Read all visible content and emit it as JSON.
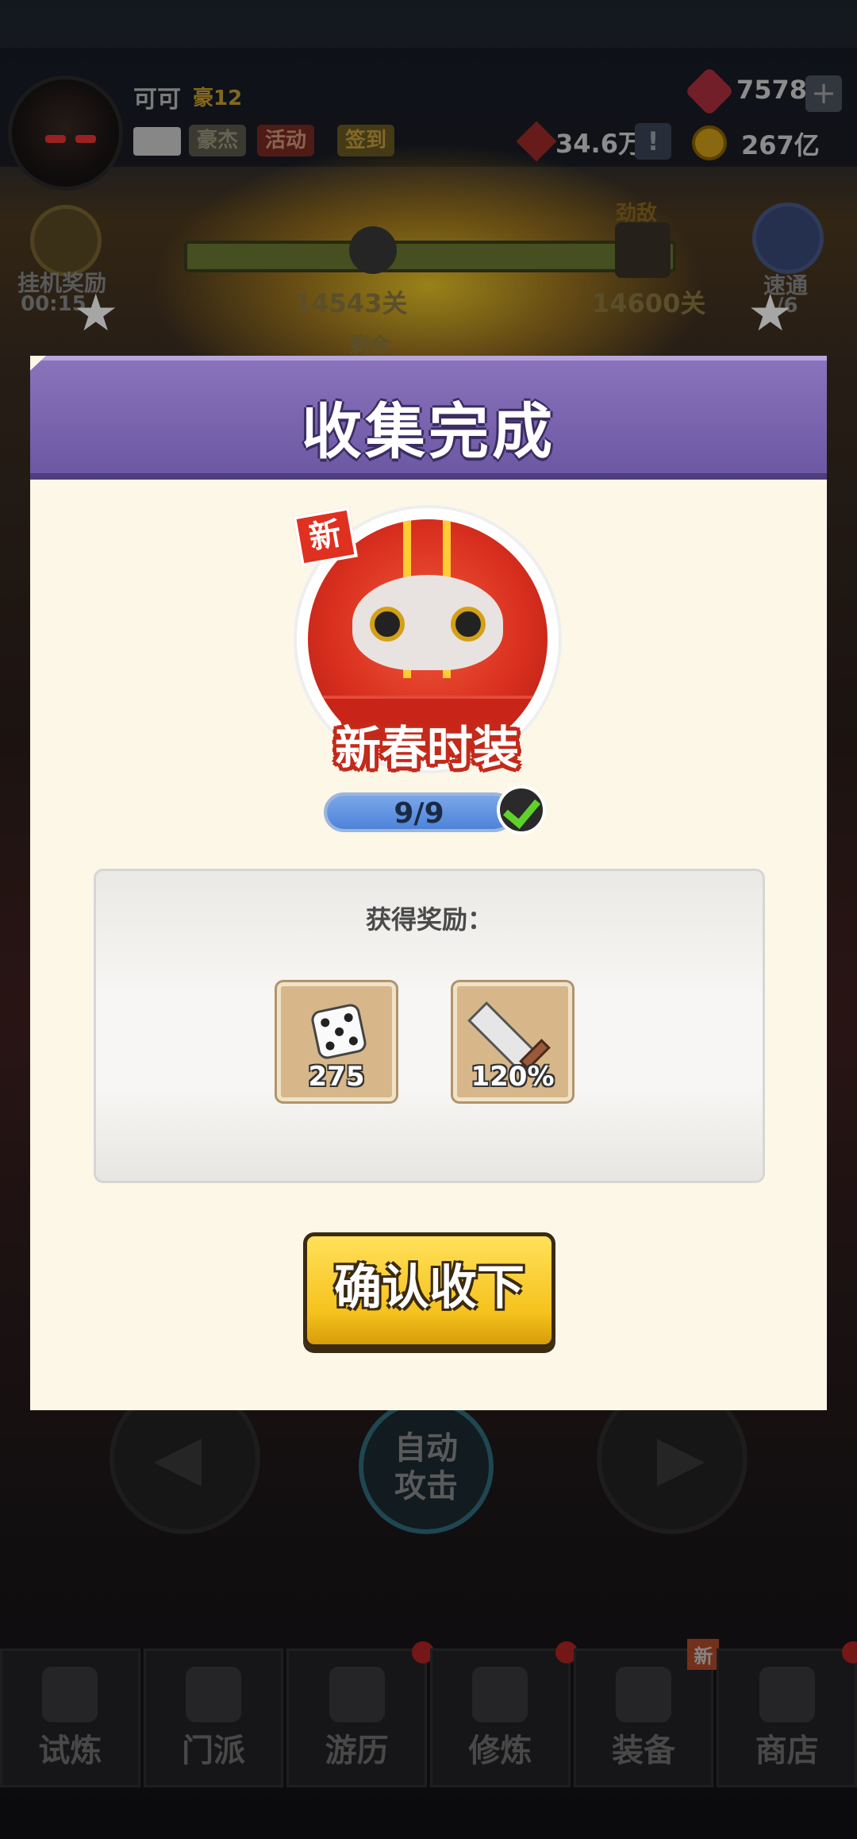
{
  "hud": {
    "player_name": "可可",
    "vip_level": "豪12",
    "buttons": {
      "hero": "豪杰",
      "event": "活动",
      "checkin": "签到"
    },
    "power": "34.6万",
    "power_info": "!",
    "gems": "7578",
    "gems_add": "+",
    "coins": "267亿"
  },
  "stage": {
    "current_stage": "14543关",
    "boss_tag": "劲敌",
    "boss_stage": "14600关",
    "remaining_label": "剩余"
  },
  "side": {
    "idle_reward_label": "挂机奖励",
    "idle_timer": "00:15",
    "sweep_label": "速通",
    "sweep_count": "/6"
  },
  "controls": {
    "auto_attack": "自动攻击"
  },
  "bottom_nav": [
    {
      "label": "试炼",
      "icon": "ninja-icon",
      "dot": false,
      "new": false
    },
    {
      "label": "门派",
      "icon": "temple-icon",
      "dot": false,
      "new": false
    },
    {
      "label": "游历",
      "icon": "landscape-icon",
      "dot": true,
      "new": false
    },
    {
      "label": "修炼",
      "icon": "scroll-icon",
      "dot": true,
      "new": false
    },
    {
      "label": "装备",
      "icon": "sword-icon",
      "dot": false,
      "new": true,
      "new_label": "新"
    },
    {
      "label": "商店",
      "icon": "shop-icon",
      "dot": true,
      "new": false
    }
  ],
  "popup": {
    "title": "收集完成",
    "new_badge": "新",
    "collection_name": "新春时装",
    "progress_text": "9/9",
    "progress_fraction": 1.0,
    "reward_title": "获得奖励：",
    "rewards": [
      {
        "icon": "dice-icon",
        "qty": "275"
      },
      {
        "icon": "sword-icon",
        "qty": "120%"
      }
    ],
    "confirm_label": "确认收下"
  },
  "colors": {
    "header_purple": "#7a65b0",
    "popup_bg": "#fdf7e8",
    "confirm_yellow": "#f6c21d",
    "progress_blue": "#4d83d8",
    "check_green": "#5fd12a"
  }
}
